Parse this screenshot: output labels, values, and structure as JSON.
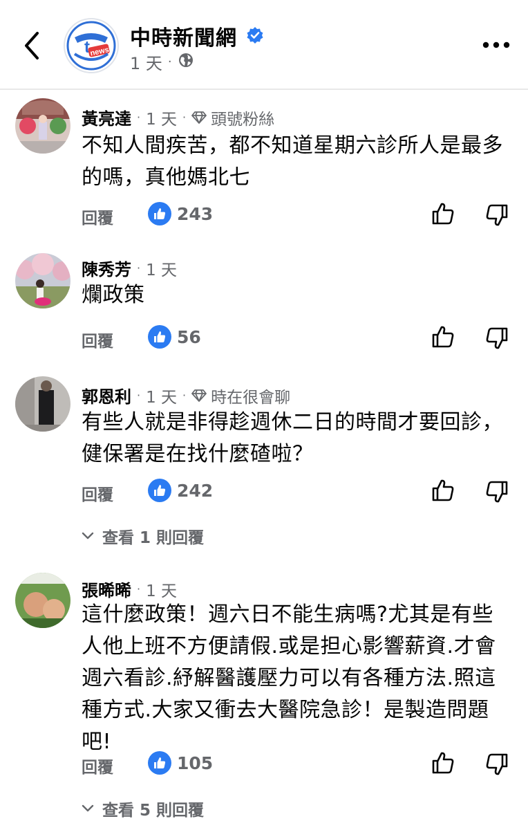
{
  "header": {
    "page_name": "中時新聞網",
    "time": "1 天",
    "dot": "·"
  },
  "colors": {
    "accent": "#2b7bf2",
    "secondary_text": "#65676b"
  },
  "comments": [
    {
      "name": "黃亮達",
      "time": "1 天",
      "badge": "頭號粉絲",
      "text": "不知人間疾苦，都不知道星期六診所人是最多的嗎，真他媽北七",
      "reply_label": "回覆",
      "likes": "243"
    },
    {
      "name": "陳秀芳",
      "time": "1 天",
      "text": "爛政策",
      "reply_label": "回覆",
      "likes": "56"
    },
    {
      "name": "郭恩利",
      "time": "1 天",
      "badge": "時在很會聊",
      "text": "有些人就是非得趁週休二日的時間才要回診，健保署是在找什麼碴啦？",
      "reply_label": "回覆",
      "likes": "242",
      "view_replies": "查看 1 則回覆"
    },
    {
      "name": "張晞晞",
      "time": "1 天",
      "text": "這什麼政策！週六日不能生病嗎?尤其是有些人他上班不方便請假.或是担心影響薪資.才會週六看診.紓解醫護壓力可以有各種方法.照這種方式.大家又衝去大醫院急診！是製造問題吧!",
      "reply_label": "回覆",
      "likes": "105",
      "view_replies": "查看 5 則回覆"
    }
  ]
}
